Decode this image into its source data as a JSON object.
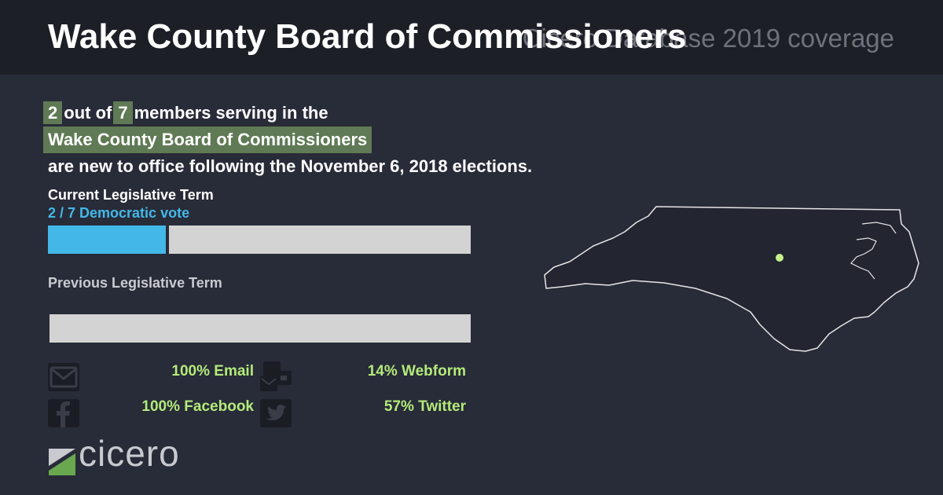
{
  "header": {
    "title": "Wake County Board of Commissioners",
    "subtitle": "Cicero Database 2019 coverage"
  },
  "summary": {
    "new_count": "2",
    "out_of_text": "out of",
    "total": "7",
    "members_text": "members serving in the",
    "body_name": "Wake County Board of Commissioners",
    "closing_text": "are new to office following the November 6, 2018 elections."
  },
  "current_term": {
    "label": "Current Legislative Term",
    "vote_text": "2 / 7 Democratic vote",
    "democratic_fraction": 0.2857,
    "democratic_color": "#43b8e8",
    "other_color": "#d3d3d3"
  },
  "previous_term": {
    "label": "Previous Legislative Term",
    "democratic_fraction": 0,
    "other_color": "#d3d3d3"
  },
  "contacts": [
    {
      "icon": "email-icon",
      "label": "100% Email"
    },
    {
      "icon": "webform-icon",
      "label": "14% Webform"
    },
    {
      "icon": "facebook-icon",
      "label": "100% Facebook"
    },
    {
      "icon": "twitter-icon",
      "label": "57% Twitter"
    }
  ],
  "map": {
    "region": "North Carolina",
    "marker_color": "#c6f08a"
  },
  "logo": {
    "text": "cicero"
  }
}
